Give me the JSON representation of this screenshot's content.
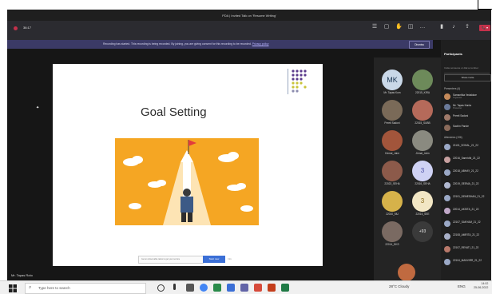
{
  "window": {
    "title": "PDA | Invited Talk on 'Resume Writing'"
  },
  "call": {
    "timer": "36:17",
    "leave_label": "📞 ▾"
  },
  "banner": {
    "text": "Recording has started. This recording is being recorded. By joining, you are giving consent for this recording to be recorded.",
    "link": "Privacy policy",
    "dismiss": "Dismiss"
  },
  "slide": {
    "title": "Goal Setting",
    "caption_placeholder": "Get an observable tasks to get your service",
    "caption_button": "Start now",
    "caption_extra": "Info"
  },
  "presenter": {
    "name": "Mr. Tapas Roto"
  },
  "gallery": {
    "tiles": [
      {
        "name": "Mr. Tapas Kum",
        "initials": "MK"
      },
      {
        "name": "22015_KIRA",
        "initials": ""
      },
      {
        "name": "Preeti Sadoni",
        "initials": ""
      },
      {
        "name": "22015_SUBB",
        "initials": ""
      },
      {
        "name": "Hemal_Jaim",
        "initials": ""
      },
      {
        "name": "Jirmal_Jaim",
        "initials": ""
      },
      {
        "name": "22023_SEHA",
        "initials": ""
      },
      {
        "name": "22016_SEHA",
        "initials": "3"
      },
      {
        "name": "22010_MU",
        "initials": ""
      },
      {
        "name": "22016_SEE",
        "initials": "3"
      },
      {
        "name": "22014_DKS",
        "initials": ""
      },
      {
        "name": "",
        "initials": "+93"
      }
    ]
  },
  "panel": {
    "title": "Participants",
    "invite_placeholder": "Invite someone or dial a number",
    "share_label": "Share invite",
    "presenters_label": "Presenters (4)",
    "presenters": [
      {
        "name": "Samantika Vedakkoe",
        "role": "Organiser"
      },
      {
        "name": "Mr. Tapas Kanta",
        "role": "Presenter"
      },
      {
        "name": "Preeti Sadoni",
        "role": ""
      },
      {
        "name": "Sachin Pande",
        "role": ""
      }
    ],
    "attendees_label": "Attendees (196)",
    "attendees": [
      {
        "name": "21101_SOHAL_21_22"
      },
      {
        "name": "22016_Samridhi_21_22"
      },
      {
        "name": "22018_ABHAY_21_22"
      },
      {
        "name": "22019_SEEMA_21_22"
      },
      {
        "name": "22101_DEMESHAN_21_22"
      },
      {
        "name": "22014_AKSITA_21_22"
      },
      {
        "name": "22107_SANYAM_21_22"
      },
      {
        "name": "22108_AMRITA_21_22"
      },
      {
        "name": "22107_REVATI_21_22"
      },
      {
        "name": "22104_MANVIRR_21_22"
      }
    ]
  },
  "taskbar": {
    "search_placeholder": "Type here to search",
    "weather": "28°C Cloudy",
    "lang": "ENG",
    "time": "14:02",
    "date": "25-06-2022"
  },
  "colors": {
    "teams_purple": "#6264a7",
    "leave_red": "#c4314b",
    "slide_yellow": "#f5a623"
  }
}
